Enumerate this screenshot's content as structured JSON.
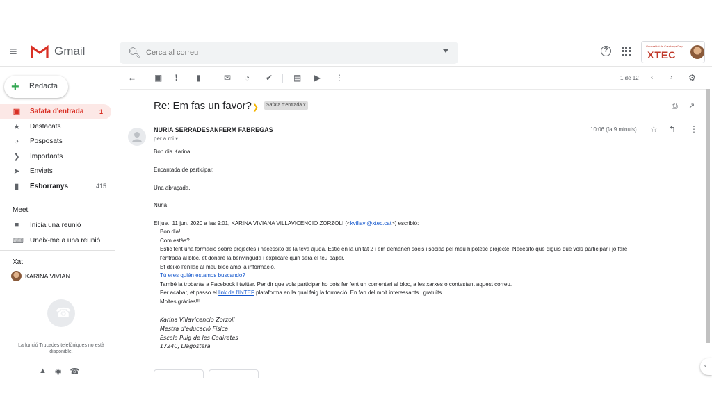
{
  "brand": {
    "name": "Gmail"
  },
  "search": {
    "placeholder": "Cerca al correu"
  },
  "account": {
    "org_label": "XTEC",
    "org_small": "Generalitat de Catalunya Departament d'Educació"
  },
  "compose": {
    "label": "Redacta"
  },
  "nav": {
    "items": [
      {
        "label": "Safata d'entrada",
        "count": "1",
        "icon": "inbox-icon",
        "active": true
      },
      {
        "label": "Destacats",
        "count": "",
        "icon": "star-icon"
      },
      {
        "label": "Posposats",
        "count": "",
        "icon": "clock-icon"
      },
      {
        "label": "Importants",
        "count": "",
        "icon": "important-icon"
      },
      {
        "label": "Enviats",
        "count": "",
        "icon": "send-icon"
      },
      {
        "label": "Esborranys",
        "count": "415",
        "icon": "draft-icon"
      }
    ]
  },
  "meet": {
    "title": "Meet",
    "start": "Inicia una reunió",
    "join": "Uneix-me a una reunió"
  },
  "chat": {
    "title": "Xat",
    "user": "KARINA VIVIAN",
    "phone_note": "La funció Trucades telefòniques no està disponible."
  },
  "toolbar": {
    "pager": "1 de 12"
  },
  "message": {
    "subject": "Re: Em fas un favor?",
    "label": "Safata d'entrada x",
    "sender": "NURIA SERRADESANFERM FABREGAS",
    "to": "per a mi ▾",
    "time": "10:06 (fa 9 minuts)",
    "body": [
      "Bon dia Karina,",
      "Encantada de participar.",
      "Una abraçada,",
      "Núria"
    ],
    "quote_header_pre": "El jue., 11 jun. 2020 a las 9:01, KARINA VIVIANA VILLAVICENCIO ZORZOLI (<",
    "quote_header_email": "kvillavi@xtec.cat",
    "quote_header_post": ">) escribió:",
    "quote": {
      "l1": "Bon dia!",
      "l2": "Com estàs?",
      "l3": "Estic fent una formació sobre projectes i necessito de la teva ajuda. Estic en la unitat 2 i em demanen socis i socias pel meu hipotètic projecte. Necesito que diguis que vols participar i jo faré",
      "l4": "l'entrada al bloc,  et donaré la benvinguda i explicaré quin serà el teu paper.",
      "l5": "Et deixo l'enllaç al meu bloc amb la informació.",
      "l6_link": "Tú eres quién estamos buscando?",
      "l7": "També la trobaràs a Facebook i twitter. Per dir que vols participar ho pots fer fent un comentari al bloc, a les xarxes o contestant aquest correu.",
      "l8_pre": "Per acabar, et passo el ",
      "l8_link": "link de l'INTEF",
      "l8_post": " plataforma en la qual faig la formació. En fan del molt interessants i gratuïts.",
      "l9": "Moltes gràcies!!!"
    },
    "signature": [
      "Karina Villavicencio Zorzoli",
      "Mestra d'educació Física",
      "Escola Puig de les Cadiretes",
      "17240, Llagostera"
    ]
  }
}
